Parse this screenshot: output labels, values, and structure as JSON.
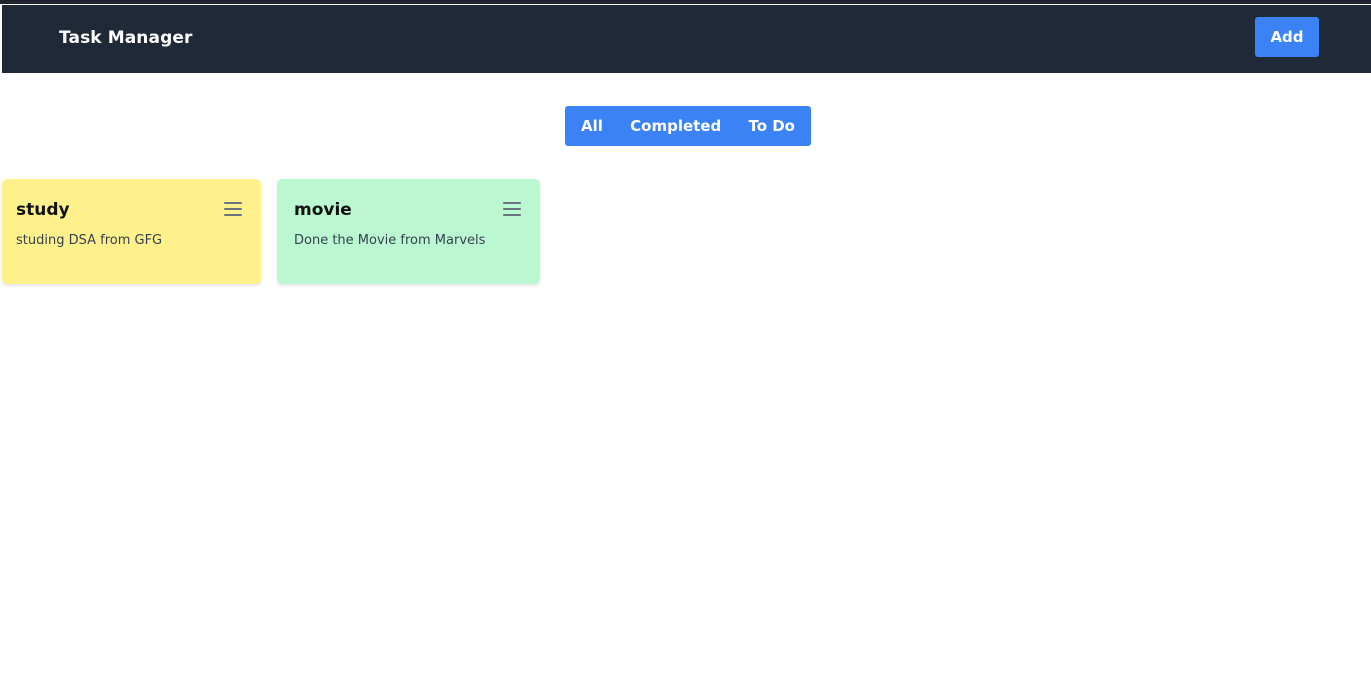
{
  "navbar": {
    "title": "Task Manager",
    "add_label": "Add",
    "background": "#202938"
  },
  "filters": {
    "tabs": [
      {
        "label": "All"
      },
      {
        "label": "Completed"
      },
      {
        "label": "To Do"
      }
    ],
    "accent": "#3b82f6"
  },
  "tasks": [
    {
      "title": "study",
      "description": "studing DSA from GFG",
      "color": "#fef08a",
      "menu_icon": "hamburger-menu-icon"
    },
    {
      "title": "movie",
      "description": "Done the Movie from Marvels",
      "color": "#bbf7d0",
      "menu_icon": "hamburger-menu-icon"
    }
  ]
}
